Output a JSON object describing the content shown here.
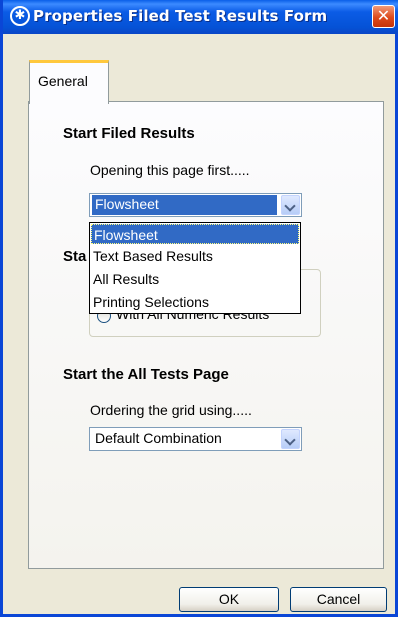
{
  "window": {
    "title": "Properties Filed Test Results Form",
    "close_symbol": "✕",
    "app_icon_symbol": "✱"
  },
  "tabs": [
    {
      "label": "General",
      "selected": true
    }
  ],
  "sections": {
    "filed_results": {
      "heading": "Start Filed Results",
      "prompt": "Opening this page first.....",
      "selected": "Flowsheet"
    },
    "hidden_section": {
      "heading_visible_fragment": "Sta",
      "radio_visible_fragment": "With All Numeric Results"
    },
    "all_tests": {
      "heading": "Start the All Tests Page",
      "prompt": "Ordering the grid using.....",
      "selected": "Default Combination"
    }
  },
  "dropdown_options": [
    "Flowsheet",
    "Text Based Results",
    "All Results",
    "Printing Selections"
  ],
  "buttons": {
    "ok": "OK",
    "cancel": "Cancel"
  },
  "colors": {
    "titlebar": "#0552d6",
    "selection": "#316ac5",
    "tab_highlight": "#ffc83c",
    "close_button": "#dd4a1b"
  }
}
